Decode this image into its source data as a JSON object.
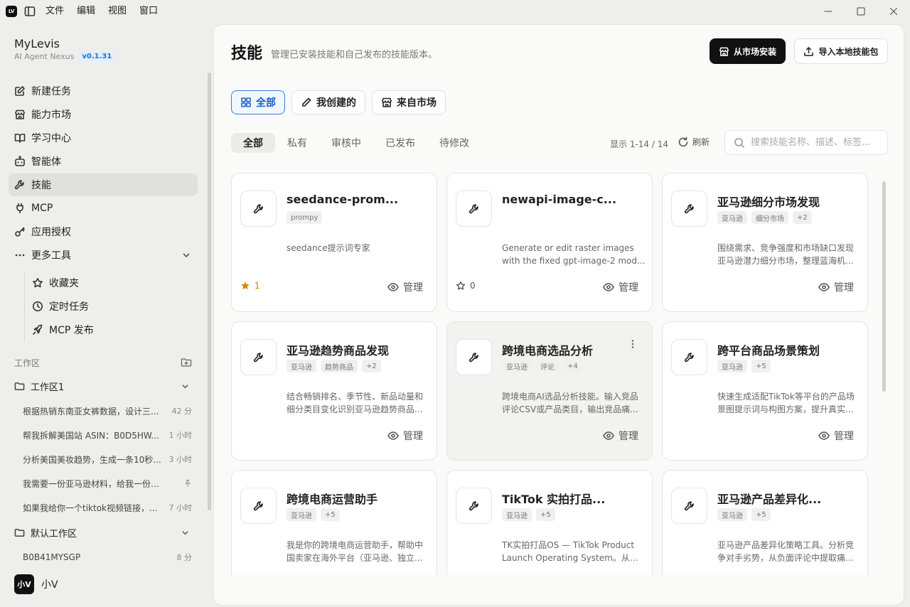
{
  "app": {
    "logo_text": "LV",
    "menus": [
      "文件",
      "编辑",
      "视图",
      "窗口"
    ]
  },
  "sidebar": {
    "brand": {
      "name": "MyLevis",
      "subtitle": "AI Agent Nexus",
      "version": "v0.1.31"
    },
    "nav": [
      {
        "label": "新建任务",
        "icon": "edit-icon"
      },
      {
        "label": "能力市场",
        "icon": "store-icon"
      },
      {
        "label": "学习中心",
        "icon": "book-icon"
      },
      {
        "label": "智能体",
        "icon": "robot-icon"
      },
      {
        "label": "技能",
        "icon": "wrench-icon",
        "active": true
      },
      {
        "label": "MCP",
        "icon": "plug-icon"
      },
      {
        "label": "应用授权",
        "icon": "key-icon"
      },
      {
        "label": "更多工具",
        "icon": "more-icon"
      }
    ],
    "subnav": [
      {
        "label": "收藏夹",
        "icon": "star-icon"
      },
      {
        "label": "定时任务",
        "icon": "clock-icon"
      },
      {
        "label": "MCP 发布",
        "icon": "rocket-icon"
      }
    ],
    "workspace_header": "工作区",
    "workspaces": [
      {
        "name": "工作区1",
        "items": [
          {
            "title": "根据热销东南亚女裤数据，设计三...",
            "time": "42 分"
          },
          {
            "title": "帮我拆解美国站 ASIN：B0D5HW...",
            "time": "1 小时"
          },
          {
            "title": "分析美国美妆趋势，生成一条10秒...",
            "time": "3 小时"
          },
          {
            "title": "我需要一份亚马逊材料，给我一份清单",
            "time": "",
            "pinned": true
          },
          {
            "title": "如果我给你一个tiktok视频链接，...",
            "time": "7 小时"
          }
        ]
      },
      {
        "name": "默认工作区",
        "items": [
          {
            "title": "B0B41MYSGP",
            "time": "8 分"
          }
        ]
      }
    ],
    "user": {
      "avatar_text": "小V",
      "name": "小V"
    }
  },
  "page": {
    "title": "技能",
    "description": "管理已安装技能和自己发布的技能版本。",
    "install_button": "从市场安装",
    "import_button": "导入本地技能包",
    "scope_tabs": [
      "全部",
      "我创建的",
      "来自市场"
    ],
    "status_tabs": [
      "全部",
      "私有",
      "审核中",
      "已发布",
      "待修改"
    ],
    "count_text": "显示 1-14 / 14",
    "refresh_label": "刷新",
    "search_placeholder": "搜索技能名称、描述、标签..."
  },
  "cards": [
    {
      "title": "seedance-prom...",
      "tags": [
        "prompy"
      ],
      "desc": "seedance提示词专家",
      "stars": "1",
      "starred": true,
      "manage": "管理"
    },
    {
      "title": "newapi-image-c...",
      "tags": [],
      "desc": "Generate or edit raster images with the fixed gpt-image-2 mod...",
      "stars": "0",
      "starred": false,
      "manage": "管理"
    },
    {
      "title": "亚马逊细分市场发现",
      "tags": [
        "亚马逊",
        "细分市场",
        "+2"
      ],
      "desc": "围绕需求、竞争强度和市场缺口发现亚马逊潜力细分市场，整理蓝海机...",
      "manage": "管理"
    },
    {
      "title": "亚马逊趋势商品发现",
      "tags": [
        "亚马逊",
        "趋势商品",
        "+2"
      ],
      "desc": "结合畅销排名、季节性、新品动量和细分类目变化识别亚马逊趋势商品...",
      "manage": "管理"
    },
    {
      "title": "跨境电商选品分析",
      "tags": [
        "亚马逊",
        "评论",
        "+4"
      ],
      "desc": "跨境电商AI选品分析技能。输入竞品评论CSV或产品类目，输出竞品痛...",
      "manage": "管理",
      "hover": true
    },
    {
      "title": "跨平台商品场景策划",
      "tags": [
        "亚马逊",
        "+5"
      ],
      "desc": "快速生成适配TikTok等平台的产品场景图提示词与构图方案，提升真实...",
      "manage": "管理"
    },
    {
      "title": "跨境电商运营助手",
      "tags": [
        "亚马逊",
        "+5"
      ],
      "desc": "我是你的跨境电商运营助手，帮助中国卖家在海外平台（亚马逊、独立...",
      "manage": "管理"
    },
    {
      "title": "TikTok 实拍打品...",
      "tags": [
        "亚马逊",
        "+5"
      ],
      "desc": "TK实拍打品OS — TikTok Product Launch Operating System。从产...",
      "manage": "管理"
    },
    {
      "title": "亚马逊产品差异化...",
      "tags": [
        "亚马逊",
        "+5"
      ],
      "desc": "亚马逊产品差异化策略工具。分析竞争对手劣势，从负面评论中提取痛...",
      "manage": "管理"
    }
  ]
}
